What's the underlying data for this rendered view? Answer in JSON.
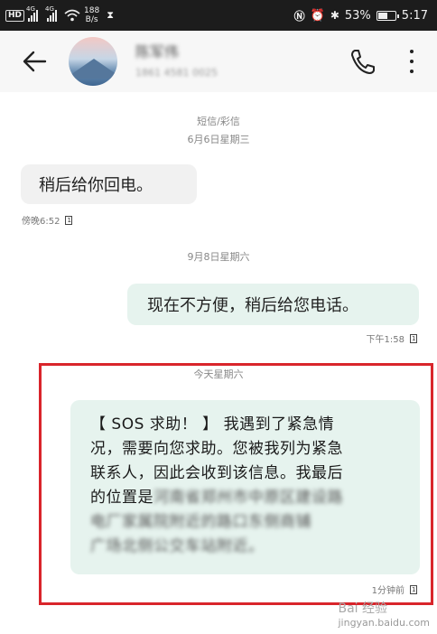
{
  "status_bar": {
    "hd": "HD",
    "signal1_tag": "4G",
    "signal2_tag": "4G",
    "net_speed": "188",
    "net_unit": "B/s",
    "battery_percent": "53%",
    "battery_level": 0.53,
    "time": "5:17"
  },
  "header": {
    "contact_name": "陈军伟",
    "contact_number": "1861 4581 0025"
  },
  "conversation": {
    "sms_label": "短信/彩信",
    "date1": "6月6日星期三",
    "msg1": {
      "text": "稍后给你回电。",
      "time": "傍晚6:52",
      "sim": "1"
    },
    "date2": "9月8日星期六",
    "msg2": {
      "text": "现在不方便，稍后给您电话。",
      "time": "下午1:58",
      "sim": "1"
    },
    "date3": "今天星期六",
    "msg3": {
      "line1": "【 SOS 求助！ 】 我遇到了紧急情",
      "line2": "况，需要向您求助。您被我列为紧急",
      "line3": "联系人，因此会收到该信息。我最后",
      "line4_visible": "的位置是",
      "line4_blurred": "河南省郑州市中原区建设路",
      "line5_blurred": "电厂家属院附近的路口东侧商铺",
      "line6_blurred": "广场北侧公交车站附近。",
      "time": "1分钟前",
      "sim": "1"
    }
  },
  "watermark": {
    "main": "Bai 经验",
    "sub": "jingyan.baidu.com"
  },
  "colors": {
    "incoming_bubble": "#f1f1f1",
    "outgoing_bubble": "#e6f3ee",
    "highlight_border": "#d9252b"
  }
}
